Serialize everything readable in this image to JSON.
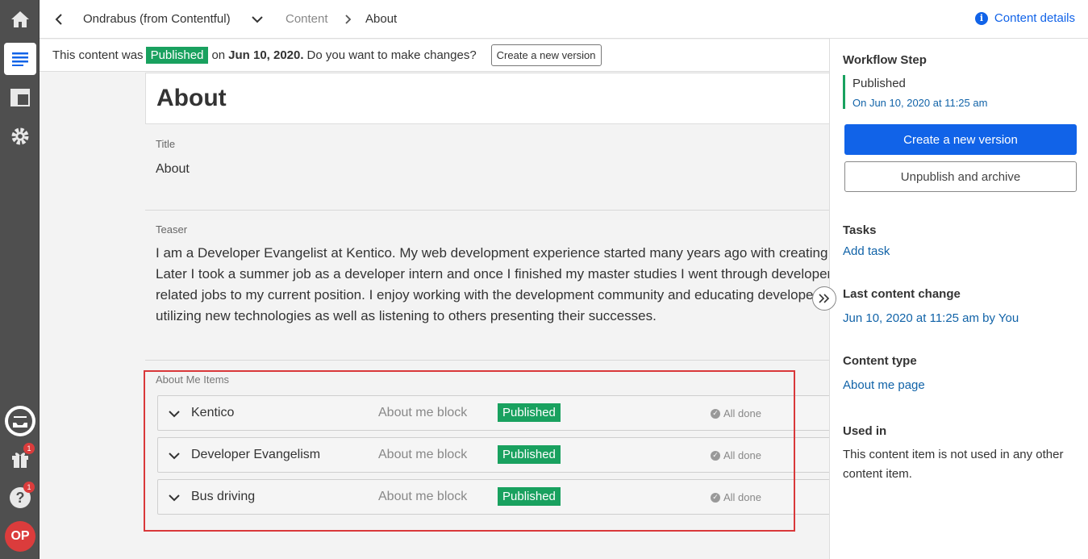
{
  "rail": {
    "icons": [
      "home-icon",
      "content-list-icon",
      "layout-icon",
      "settings-icon",
      "inbox-icon",
      "gift-icon",
      "help-icon"
    ],
    "gift_badge": "1",
    "help_badge": "1",
    "avatar_initials": "OP"
  },
  "topbar": {
    "project": "Ondrabus (from Contentful)",
    "section": "Content",
    "current": "About",
    "details_label": "Content details"
  },
  "notice": {
    "prefix": "This content was",
    "status": "Published",
    "on": "on",
    "date": "Jun 10, 2020.",
    "question": "Do you want to make changes?",
    "button": "Create a new version"
  },
  "item": {
    "name": "About",
    "fields": {
      "title_label": "Title",
      "title_value": "About",
      "teaser_label": "Teaser",
      "teaser_lines": [
        "I am a Developer Evangelist at Kentico. My web development experience started many years ago with creating webs",
        "Later I took a summer job as a developer intern and once I finished my master studies I went through developer and",
        "related jobs to my current position. I enjoy working with the development community and educating developers",
        "utilizing new technologies as well as listening to others presenting their successes."
      ],
      "items_label": "About Me Items"
    },
    "linked_items": [
      {
        "name": "Kentico",
        "type": "About me block",
        "status": "Published",
        "done": "All done"
      },
      {
        "name": "Developer Evangelism",
        "type": "About me block",
        "status": "Published",
        "done": "All done"
      },
      {
        "name": "Bus driving",
        "type": "About me block",
        "status": "Published",
        "done": "All done"
      }
    ]
  },
  "sidebar": {
    "workflow_heading": "Workflow Step",
    "workflow_status": "Published",
    "workflow_date": "On Jun 10, 2020 at 11:25 am",
    "primary_button": "Create a new version",
    "secondary_button": "Unpublish and archive",
    "tasks_heading": "Tasks",
    "add_task": "Add task",
    "last_change_heading": "Last content change",
    "last_change_value": "Jun 10, 2020 at 11:25 am by You",
    "type_heading": "Content type",
    "type_value": "About me page",
    "used_in_heading": "Used in",
    "used_in_text": "This content item is not used in any other content item."
  },
  "colors": {
    "accent": "#1163e8",
    "published": "#19a15f",
    "highlight_box": "#d9383a",
    "rail": "#4f4f4f"
  }
}
